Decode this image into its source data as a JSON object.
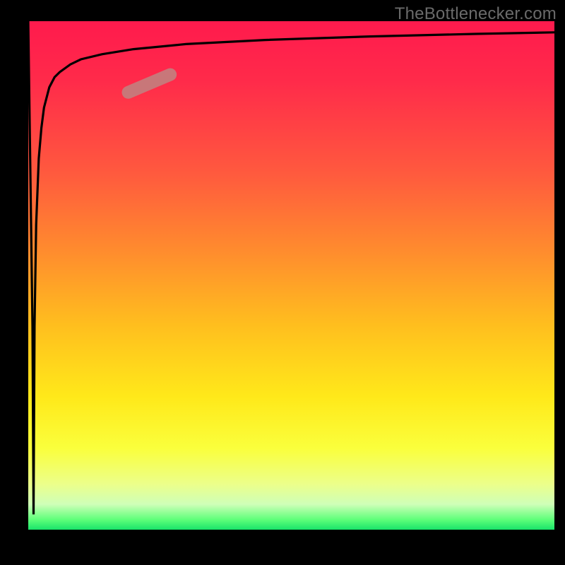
{
  "watermark": "TheBottlenecker.com",
  "chart_data": {
    "type": "line",
    "title": "",
    "xlabel": "",
    "ylabel": "",
    "xlim": [
      0,
      100
    ],
    "ylim": [
      0,
      100
    ],
    "series": [
      {
        "name": "bottleneck-curve",
        "x": [
          0,
          0.8,
          1,
          1.2,
          1.5,
          2,
          2.5,
          3,
          4,
          5,
          6,
          8,
          10,
          14,
          20,
          30,
          45,
          65,
          85,
          100
        ],
        "y": [
          100,
          40,
          3,
          40,
          60,
          73,
          79,
          83,
          87,
          89,
          90,
          91.5,
          92.5,
          93.5,
          94.5,
          95.5,
          96.3,
          97,
          97.5,
          97.8
        ]
      }
    ],
    "marker": {
      "x_start": 19,
      "y_start": 86,
      "x_end": 27,
      "y_end": 89.5
    },
    "background_gradient": {
      "top": "#ff1a4d",
      "mid": "#ffe91a",
      "bottom": "#19e36a"
    },
    "axes_visible": false,
    "grid": false
  }
}
